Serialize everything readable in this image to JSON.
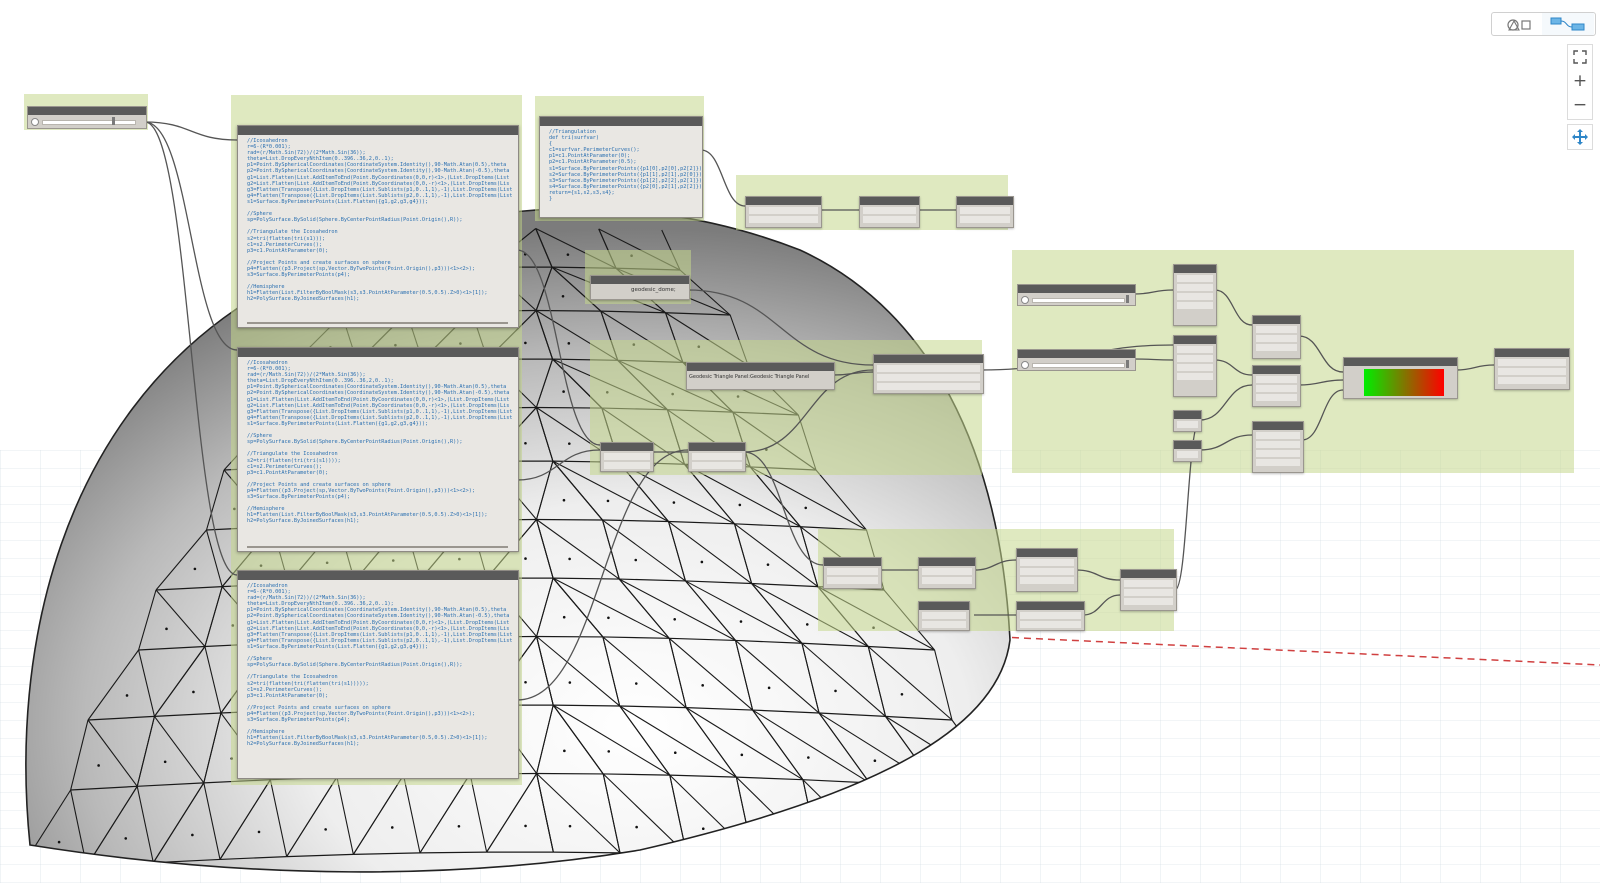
{
  "view_toggle": {
    "geometry_view_icon": "shapes-icon",
    "graph_view_icon": "node-graph-icon"
  },
  "zoom_controls": {
    "fit_icon": "zoom-to-fit-icon",
    "zoom_in": "+",
    "zoom_out": "−",
    "pan_icon": "pan-icon"
  },
  "code_block": {
    "main": "//Icosahedron\nr=6-(R*0.001);\nrad=(r/Math.Sin(72))/(2*Math.Sin(36));\ntheta=List.DropEveryNthItem(0..396..36,2,0..1);\np1=Point.BySphericalCoordinates(CoordinateSystem.Identity(),90-Math.Atan(0.5),theta\np2=Point.BySphericalCoordinates(CoordinateSystem.Identity(),90-Math.Atan(-0.5),theta\ng1=List.Flatten(List.AddItemToEnd(Point.ByCoordinates(0,0,r)<1>,(List.DropItems(List\ng2=List.Flatten(List.AddItemToEnd(Point.ByCoordinates(0,0,-r)<1>,(List.DropItems(Lis\ng3=Flatten(Transpose({List.DropItems(List.Sublists(p1,0..1,1),-1),List.DropItems(List\ng4=Flatten(Transpose({List.DropItems(List.Sublists(p2,0..1,1),-1),List.DropItems(List\ns1=Surface.ByPerimeterPoints(List.Flatten({g1,g2,g3,g4}));\n\n//Sphere\nsp=PolySurface.BySolid(Sphere.ByCenterPointRadius(Point.Origin(),R));\n\n//Triangulate the Icosahedron\ns2=tri(flatten(tri(s1)));\nc1=s2.PerimeterCurves();\np3=c1.PointAtParameter(0);\n\n//Project Points and create surfaces on sphere\np4=Flatten((p3.Project(sp,Vector.ByTwoPoints(Point.Origin(),p3)))<1><2>);\ns3=Surface.ByPerimeterPoints(p4);\n\n//Hemisphere\nh1=Flatten(List.FilterByBoolMask(s3,s3.PointAtParameter(0.5,0.5).Z>0)<1>[1]);\nh2=PolySurface.ByJoinedSurfaces(h1);",
    "middle": "//Icosahedron\nr=6-(R*0.001);\nrad=(r/Math.Sin(72))/(2*Math.Sin(36));\ntheta=List.DropEveryNthItem(0..396..36,2,0..1);\np1=Point.BySphericalCoordinates(CoordinateSystem.Identity(),90-Math.Atan(0.5),theta\np2=Point.BySphericalCoordinates(CoordinateSystem.Identity(),90-Math.Atan(-0.5),theta\ng1=List.Flatten(List.AddItemToEnd(Point.ByCoordinates(0,0,r)<1>,(List.DropItems(List\ng2=List.Flatten(List.AddItemToEnd(Point.ByCoordinates(0,0,-r)<1>,(List.DropItems(Lis\ng3=Flatten(Transpose({List.DropItems(List.Sublists(p1,0..1,1),-1),List.DropItems(List\ng4=Flatten(Transpose({List.DropItems(List.Sublists(p2,0..1,1),-1),List.DropItems(List\ns1=Surface.ByPerimeterPoints(List.Flatten({g1,g2,g3,g4}));\n\n//Sphere\nsp=PolySurface.BySolid(Sphere.ByCenterPointRadius(Point.Origin(),R));\n\n//Triangulate the Icosahedron\ns2=tri(flatten(tri(tri(s1))));\nc1=s2.PerimeterCurves();\np3=c1.PointAtParameter(0);\n\n//Project Points and create surfaces on sphere\np4=Flatten((p3.Project(sp,Vector.ByTwoPoints(Point.Origin(),p3)))<1><2>);\ns3=Surface.ByPerimeterPoints(p4);\n\n//Hemisphere\nh1=Flatten(List.FilterByBoolMask(s3,s3.PointAtParameter(0.5,0.5).Z>0)<1>[1]);\nh2=PolySurface.ByJoinedSurfaces(h1);",
    "bottom": "//Icosahedron\nr=6-(R*0.001);\nrad=(r/Math.Sin(72))/(2*Math.Sin(36));\ntheta=List.DropEveryNthItem(0..396..36,2,0..1);\np1=Point.BySphericalCoordinates(CoordinateSystem.Identity(),90-Math.Atan(0.5),theta\np2=Point.BySphericalCoordinates(CoordinateSystem.Identity(),90-Math.Atan(-0.5),theta\ng1=List.Flatten(List.AddItemToEnd(Point.ByCoordinates(0,0,r)<1>,(List.DropItems(List\ng2=List.Flatten(List.AddItemToEnd(Point.ByCoordinates(0,0,-r)<1>,(List.DropItems(Lis\ng3=Flatten(Transpose({List.DropItems(List.Sublists(p1,0..1,1),-1),List.DropItems(List\ng4=Flatten(Transpose({List.DropItems(List.Sublists(p2,0..1,1),-1),List.DropItems(List\ns1=Surface.ByPerimeterPoints(List.Flatten({g1,g2,g3,g4}));\n\n//Sphere\nsp=PolySurface.BySolid(Sphere.ByCenterPointRadius(Point.Origin(),R));\n\n//Triangulate the Icosahedron\ns2=tri(flatten(tri(flatten(tri(s1)))));\nc1=s2.PerimeterCurves();\np3=c1.PointAtParameter(0);\n\n//Project Points and create surfaces on sphere\np4=Flatten((p3.Project(sp,Vector.ByTwoPoints(Point.Origin(),p3)))<1><2>);\ns3=Surface.ByPerimeterPoints(p4);\n\n//Hemisphere\nh1=Flatten(List.FilterByBoolMask(s3,s3.PointAtParameter(0.5,0.5).Z>0)<1>[1]);\nh2=PolySurface.ByJoinedSurfaces(h1);",
    "triangulation": "//Triangulation\ndef tri(surfvar)\n{\nc1=surfvar.PerimeterCurves();\np1=c1.PointAtParameter(0);\np2=c1.PointAtParameter(0.5);\ns1=Surface.ByPerimeterPoints({p1[0],p2[0],p2[2]});\ns2=Surface.ByPerimeterPoints({p1[1],p2[1],p2[0]});\ns3=Surface.ByPerimeterPoints({p1[2],p2[2],p2[1]});\ns4=Surface.ByPerimeterPoints({p2[0],p2[1],p2[2]});\nreturn={s1,s2,s3,s4};\n}"
  },
  "nodes": {
    "string_node_value": "geodesic_dome;",
    "family_type_value": "Geodesic Triangle Panel:Geodesic Triangle Panel"
  },
  "colors": {
    "canvas_background": "#ffffff",
    "group_fill": "#c5d78c",
    "node_header": "#5a5a5a",
    "node_body": "#d2cfc9",
    "code_text": "#2a6fb0",
    "gradient_start": "#00ee00",
    "gradient_end": "#ff0000",
    "axis_dash": "#d04040"
  }
}
